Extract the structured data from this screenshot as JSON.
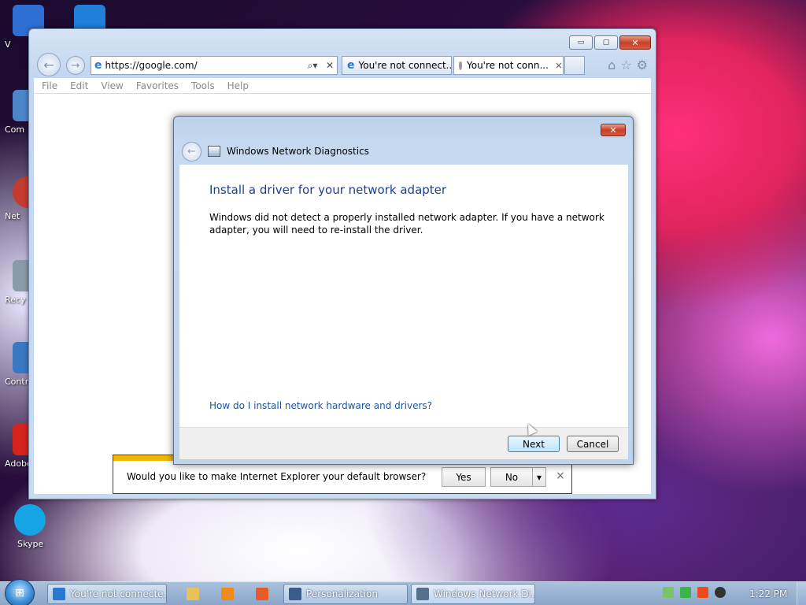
{
  "desktop": {
    "icons": [
      {
        "label": "V",
        "color": "#2f6fd1"
      },
      {
        "label": "Com",
        "color": "#4c86c9"
      },
      {
        "label": "Net",
        "color": "#c43a2c"
      },
      {
        "label": "Recy",
        "color": "#8a9aa8"
      },
      {
        "label": "Contro",
        "color": "#3a78c2"
      },
      {
        "label": "Adobe",
        "color": "#d4231b"
      },
      {
        "label": "Skype",
        "color": "#15a5e4"
      }
    ]
  },
  "browser": {
    "address": "https://google.com/",
    "tabs": [
      {
        "title": "You're not connect...",
        "loading": false
      },
      {
        "title": "You're not conn...",
        "loading": true
      }
    ],
    "tab_close": "×",
    "menu": [
      "File",
      "Edit",
      "View",
      "Favorites",
      "Tools",
      "Help"
    ],
    "controls": {
      "minimize": "▭",
      "maximize": "▢",
      "close": "✕"
    },
    "address_search_glyph": "⌕▾",
    "address_stop_glyph": "✕",
    "toolbar_icons": [
      "home-icon",
      "favorites-star-icon",
      "settings-gear-icon"
    ]
  },
  "notification": {
    "message": "Would you like to make Internet Explorer your default browser?",
    "yes": "Yes",
    "no": "No",
    "dropdown": "▾",
    "close": "×",
    "accent_color": "#f2b600"
  },
  "dialog": {
    "title": "Windows Network Diagnostics",
    "heading": "Install a driver for your network adapter",
    "body": "Windows did not detect a properly installed network adapter. If you have a network adapter, you will need to re-install the driver.",
    "link": "How do I install network hardware and drivers?",
    "next": "Next",
    "cancel": "Cancel",
    "close": "✕",
    "heading_color": "#1e3f91",
    "link_color": "#1a56a6"
  },
  "taskbar": {
    "start_glyph": "⊞",
    "buttons": [
      {
        "label": "You're not connecte...",
        "icon": "internet-explorer-icon"
      },
      {
        "label": "Personalization",
        "icon": "personalization-icon"
      },
      {
        "label": "Windows Network Di...",
        "icon": "network-diagnostics-icon"
      }
    ],
    "pinned": [
      "file-explorer-icon",
      "media-player-icon",
      "app-icon"
    ],
    "tray": [
      "action-center-icon",
      "network-icon",
      "flag-icon",
      "volume-icon"
    ],
    "clock": "1:22 PM"
  }
}
